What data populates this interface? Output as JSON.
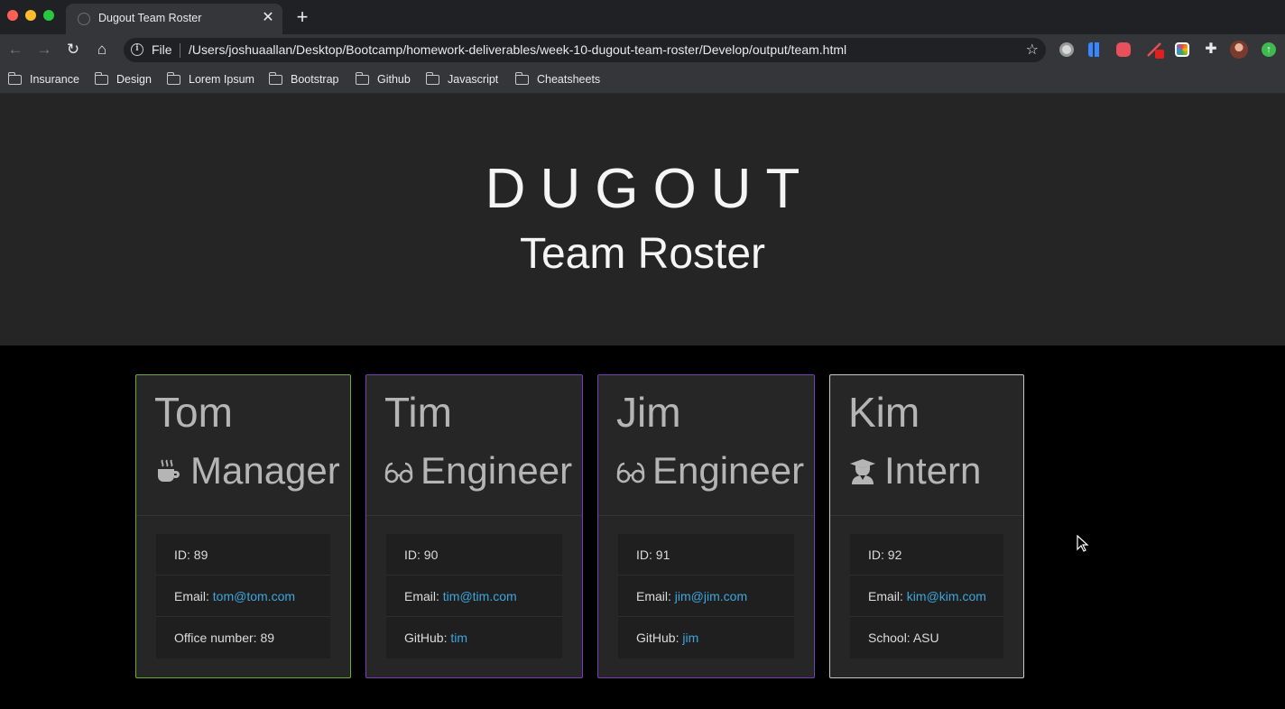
{
  "browser": {
    "tab_title": "Dugout Team Roster",
    "tab_close": "✕",
    "new_tab": "+",
    "scheme_label": "File",
    "url": "/Users/joshuaallan/Desktop/Bootcamp/homework-deliverables/week-10-dugout-team-roster/Develop/output/team.html",
    "bookmarks": [
      "Insurance",
      "Design",
      "Lorem Ipsum",
      "Bootstrap",
      "Github",
      "Javascript",
      "Cheatsheets"
    ]
  },
  "page": {
    "brand": "DUGOUT",
    "subtitle": "Team Roster"
  },
  "team": [
    {
      "name": "Tom",
      "role": "Manager",
      "icon": "coffee-icon",
      "border_color": "#6cab3c",
      "id_label": "ID: ",
      "id": "89",
      "email_label": "Email: ",
      "email": "tom@tom.com",
      "extra_label": "Office number: ",
      "extra": "89"
    },
    {
      "name": "Tim",
      "role": "Engineer",
      "icon": "glasses-icon",
      "border_color": "#7a3db8",
      "id_label": "ID: ",
      "id": "90",
      "email_label": "Email: ",
      "email": "tim@tim.com",
      "extra_label": "GitHub: ",
      "extra": "tim"
    },
    {
      "name": "Jim",
      "role": "Engineer",
      "icon": "glasses-icon",
      "border_color": "#7a3db8",
      "id_label": "ID: ",
      "id": "91",
      "email_label": "Email: ",
      "email": "jim@jim.com",
      "extra_label": "GitHub: ",
      "extra": "jim"
    },
    {
      "name": "Kim",
      "role": "Intern",
      "icon": "graduate-icon",
      "border_color": "#c8c8c8",
      "id_label": "ID: ",
      "id": "92",
      "email_label": "Email: ",
      "email": "kim@kim.com",
      "extra_label": "School: ",
      "extra": "ASU"
    }
  ],
  "colors": {
    "hero_bg": "#252526",
    "page_bg": "#000000",
    "link": "#3ea6dc"
  }
}
